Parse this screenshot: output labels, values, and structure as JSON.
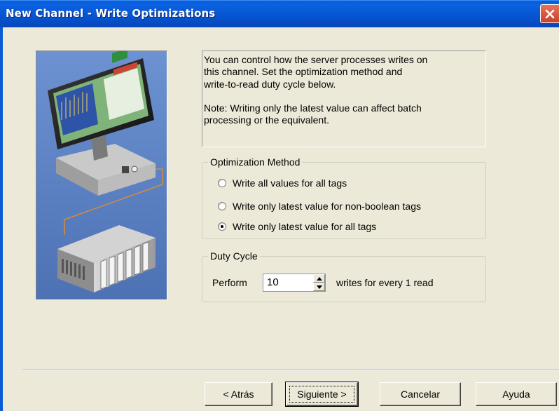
{
  "window": {
    "title": "New Channel - Write Optimizations"
  },
  "description": {
    "paragraph1": "You can control how the server processes writes on\nthis channel.  Set the optimization method and\nwrite-to-read duty cycle below.",
    "paragraph2": "Note:  Writing only the latest value can affect batch\nprocessing or the equivalent."
  },
  "optimization_method": {
    "label": "Optimization Method",
    "options": [
      {
        "label": "Write all values for all tags",
        "checked": false
      },
      {
        "label": "Write only latest value for non-boolean tags",
        "checked": false
      },
      {
        "label": "Write only latest value for all tags",
        "checked": true
      }
    ]
  },
  "duty_cycle": {
    "label": "Duty Cycle",
    "prefix": "Perform",
    "value": "10",
    "suffix": "writes for every 1 read"
  },
  "buttons": {
    "back": "< Atrás",
    "next": "Siguiente >",
    "cancel": "Cancelar",
    "help": "Ayuda"
  },
  "colors": {
    "titlebar": "#0654d1",
    "dialog_bg": "#ece9d8",
    "illustration_bg": "#5b80c0"
  },
  "icons": {
    "close": "close-icon",
    "spin_up": "arrow-up-icon",
    "spin_down": "arrow-down-icon",
    "illustration": "computer-plc-illustration"
  }
}
